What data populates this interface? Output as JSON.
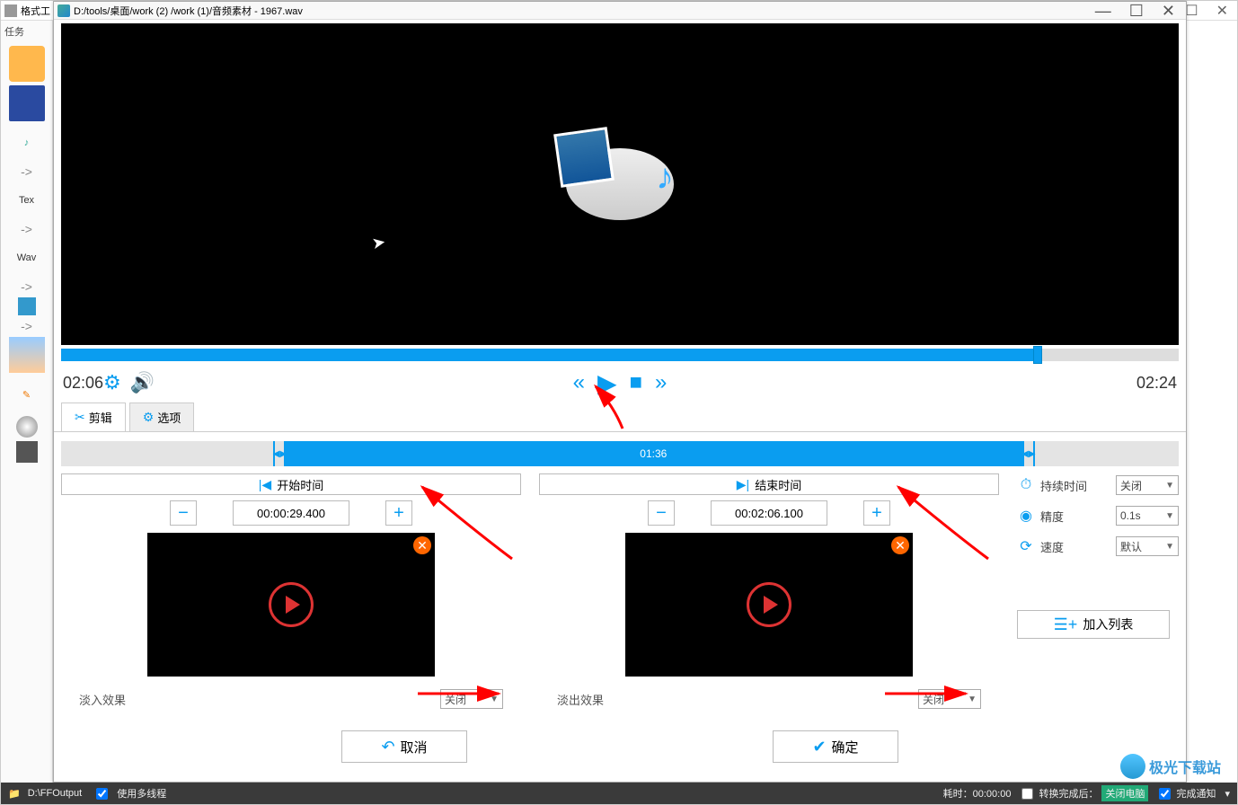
{
  "outer": {
    "title": "格式工"
  },
  "leftPanel": {
    "task": "任务",
    "tex": "Tex",
    "wav": "Wav",
    "arrow": "->"
  },
  "editor": {
    "title": "D:/tools/桌面/work (2) /work (1)/音频素材 - 1967.wav",
    "timeLeft": "02:06",
    "timeRight": "02:24"
  },
  "tabs": {
    "edit": "剪辑",
    "options": "选项"
  },
  "trim": {
    "duration": "01:36",
    "startLabel": "开始时间",
    "endLabel": "结束时间",
    "startValue": "00:00:29.400",
    "endValue": "00:02:06.100",
    "fadeInLabel": "淡入效果",
    "fadeOutLabel": "淡出效果",
    "closed": "关闭"
  },
  "side": {
    "duration": "持续时间",
    "durationVal": "关闭",
    "precision": "精度",
    "precisionVal": "0.1s",
    "speed": "速度",
    "speedVal": "默认",
    "addList": "加入列表"
  },
  "actions": {
    "cancel": "取消",
    "ok": "确定"
  },
  "status": {
    "output": "D:\\FFOutput",
    "multithread": "使用多线程",
    "elapsed": "耗时：00:00:00",
    "afterConvert": "转换完成后：",
    "shutdown": "关闭电脑",
    "notify": "完成通知"
  },
  "watermark": "极光下载站"
}
